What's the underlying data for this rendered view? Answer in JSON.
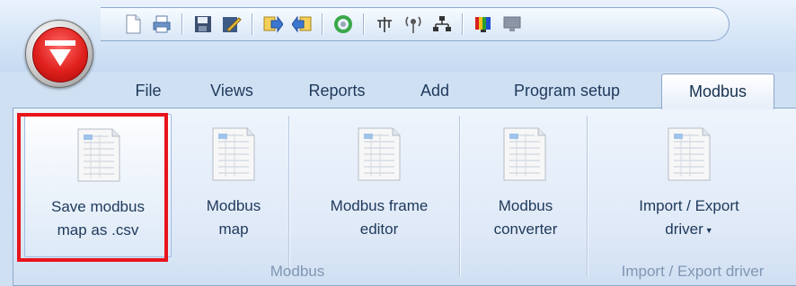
{
  "tabs": [
    {
      "label": "File"
    },
    {
      "label": "Views"
    },
    {
      "label": "Reports"
    },
    {
      "label": "Add"
    },
    {
      "label": "Program setup"
    },
    {
      "label": "Modbus",
      "active": true
    }
  ],
  "quick_access": [
    "new-document-icon",
    "print-icon",
    "save-icon",
    "edit-icon",
    "export-icon",
    "import-icon",
    "refresh-icon",
    "tree-icon",
    "antenna-icon",
    "network-icon",
    "color-palette-icon",
    "monitor-icon"
  ],
  "ribbon": {
    "buttons": [
      {
        "label": "Save modbus\nmap as .csv",
        "highlighted": true
      },
      {
        "label": "Modbus\nmap"
      },
      {
        "label": "Modbus frame\neditor"
      },
      {
        "label": "Modbus\nconverter"
      },
      {
        "label": "Import / Export\ndriver",
        "dropdown": true
      }
    ],
    "groups": [
      {
        "label": "Modbus"
      },
      {
        "label": "Import / Export driver"
      }
    ]
  },
  "colors": {
    "highlight_border": "#e8141b",
    "orb_red": "#e0201c",
    "text": "#1e395b"
  }
}
